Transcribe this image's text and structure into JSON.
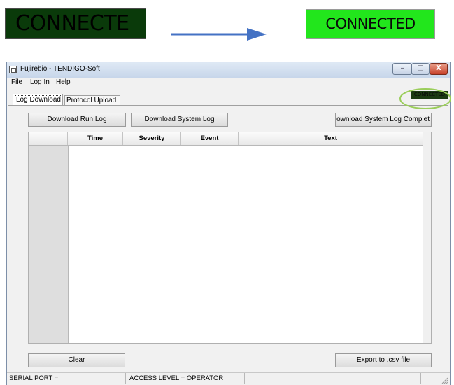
{
  "comparison": {
    "before_text": "CONNECTE",
    "after_text": "CONNECTED",
    "before_color": "#0a3a0a",
    "after_color": "#22e61c",
    "arrow_color": "#4472c4"
  },
  "window": {
    "title": "Fujirebio - TENDIGO-Soft",
    "controls": {
      "minimize": "–",
      "maximize": "□",
      "close": "X"
    }
  },
  "menu": {
    "file": "File",
    "login": "Log In",
    "help": "Help"
  },
  "tabs": [
    {
      "label": "Log Download",
      "active": true
    },
    {
      "label": "Protocol Upload",
      "active": false
    }
  ],
  "connection_indicator": {
    "text": "CONNECTED",
    "highlight_color": "#9acd5a"
  },
  "buttons": {
    "download_run_log": "Download Run Log",
    "download_system_log": "Download System Log",
    "download_system_log_complete": "ownload System Log Complet",
    "clear": "Clear",
    "export": "Export to .csv file"
  },
  "grid": {
    "columns": [
      "Time",
      "Severity",
      "Event",
      "Text"
    ],
    "rows": []
  },
  "statusbar": {
    "serial_port": "SERIAL PORT =",
    "access_level": "ACCESS LEVEL = OPERATOR"
  }
}
